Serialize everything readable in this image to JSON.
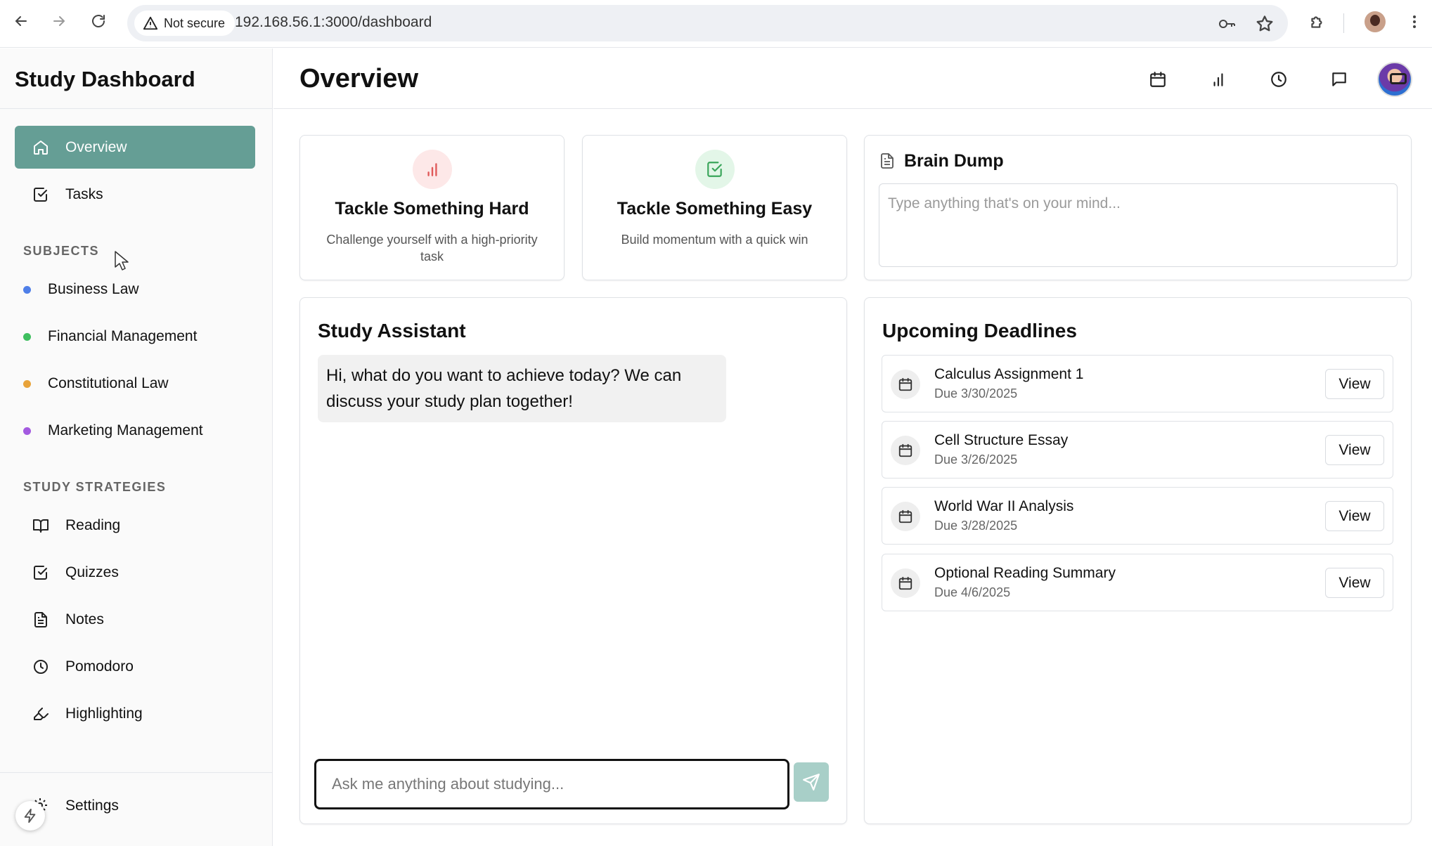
{
  "browser": {
    "security_label": "Not secure",
    "url": "192.168.56.1:3000/dashboard"
  },
  "sidebar": {
    "app_title": "Study Dashboard",
    "nav": [
      {
        "label": "Overview",
        "icon": "home-icon",
        "active": true
      },
      {
        "label": "Tasks",
        "icon": "check-square-icon",
        "active": false
      }
    ],
    "subjects_label": "SUBJECTS",
    "subjects": [
      {
        "label": "Business Law",
        "color": "#4f7fe8"
      },
      {
        "label": "Financial Management",
        "color": "#3fbf5f"
      },
      {
        "label": "Constitutional Law",
        "color": "#e8a33a"
      },
      {
        "label": "Marketing Management",
        "color": "#a35ae0"
      }
    ],
    "strategies_label": "STUDY STRATEGIES",
    "strategies": [
      {
        "label": "Reading",
        "icon": "book-open-icon"
      },
      {
        "label": "Quizzes",
        "icon": "check-square-icon"
      },
      {
        "label": "Notes",
        "icon": "file-text-icon"
      },
      {
        "label": "Pomodoro",
        "icon": "clock-icon"
      },
      {
        "label": "Highlighting",
        "icon": "highlighter-icon"
      }
    ],
    "settings_label": "Settings"
  },
  "header": {
    "title": "Overview",
    "icons": [
      "calendar-icon",
      "bar-chart-icon",
      "clock-icon",
      "message-icon"
    ]
  },
  "tackle_hard": {
    "title": "Tackle Something Hard",
    "description": "Challenge yourself with a high-priority task",
    "icon_color": "#e05a5a",
    "icon_bg": "#fde8e8"
  },
  "tackle_easy": {
    "title": "Tackle Something Easy",
    "description": "Build momentum with a quick win",
    "icon_color": "#3aa55a",
    "icon_bg": "#e3f6e8"
  },
  "brain_dump": {
    "title": "Brain Dump",
    "placeholder": "Type anything that's on your mind..."
  },
  "study_assistant": {
    "title": "Study Assistant",
    "message": "Hi, what do you want to achieve today? We can discuss your study plan together!",
    "input_placeholder": "Ask me anything about studying..."
  },
  "deadlines": {
    "title": "Upcoming Deadlines",
    "view_label": "View",
    "items": [
      {
        "title": "Calculus Assignment 1",
        "due": "Due 3/30/2025"
      },
      {
        "title": "Cell Structure Essay",
        "due": "Due 3/26/2025"
      },
      {
        "title": "World War II Analysis",
        "due": "Due 3/28/2025"
      },
      {
        "title": "Optional Reading Summary",
        "due": "Due 4/6/2025"
      }
    ]
  },
  "colors": {
    "accent": "#659e95",
    "send_button": "#a8cfc8"
  }
}
